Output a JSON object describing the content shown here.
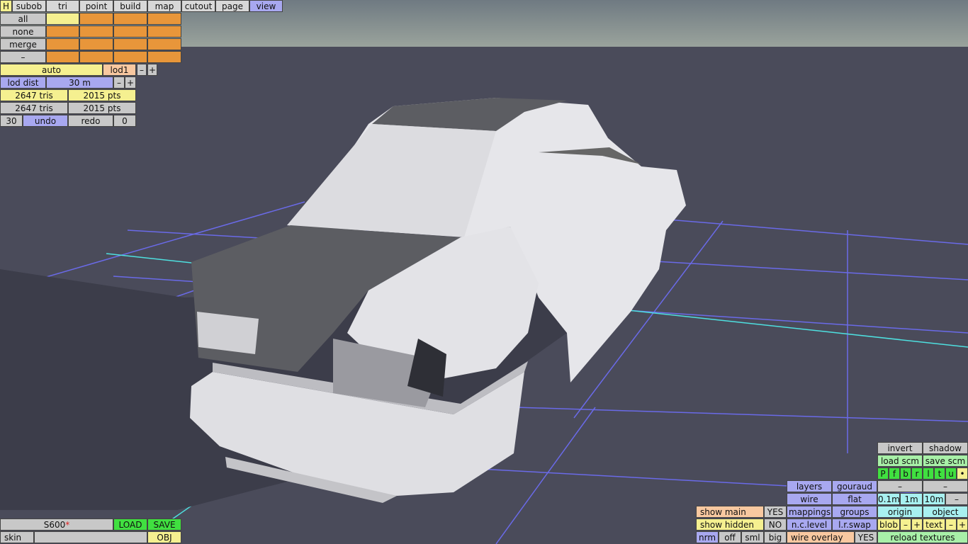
{
  "menu": {
    "h": "H",
    "subob": "subob",
    "tri": "tri",
    "point": "point",
    "build": "build",
    "map": "map",
    "cutout": "cutout",
    "page": "page",
    "view": "view"
  },
  "selection": {
    "all": "all",
    "none": "none",
    "merge": "merge",
    "dash": "–"
  },
  "lod": {
    "mode": "auto",
    "level": "lod1",
    "minus": "–",
    "plus": "+",
    "dist_label": "lod dist",
    "dist_value": "30 m"
  },
  "stats": {
    "tris1": "2647 tris",
    "pts1": "2015 pts",
    "tris2": "2647 tris",
    "pts2": "2015 pts"
  },
  "history": {
    "count": "30",
    "undo": "undo",
    "redo": "redo",
    "redo_count": "0"
  },
  "file": {
    "name": "S600",
    "modified_mark": "*",
    "load": "LOAD",
    "save": "SAVE",
    "skin": "skin",
    "obj": "OBJ"
  },
  "view_panel": {
    "invert": "invert",
    "shadow": "shadow",
    "load_scm": "load scm",
    "save_scm": "save scm",
    "views": [
      "P",
      "f",
      "b",
      "r",
      "l",
      "t",
      "u",
      "•"
    ],
    "layers": "layers",
    "gouraud": "gouraud",
    "dash1": "–",
    "dash2": "–",
    "wire": "wire",
    "flat": "flat",
    "g01": "0.1m",
    "g1": "1m",
    "g10": "10m",
    "gdash": "–",
    "show_main": "show main",
    "show_main_val": "YES",
    "mappings": "mappings",
    "groups": "groups",
    "origin": "origin",
    "object": "object",
    "show_hidden": "show hidden",
    "show_hidden_val": "NO",
    "nclevel": "n.c.level",
    "lrswap": "l.r.swap",
    "blob": "blob",
    "text": "text",
    "minus": "–",
    "plus": "+",
    "nrm": "nrm",
    "off": "off",
    "sml": "sml",
    "big": "big",
    "wire_overlay": "wire overlay",
    "wire_overlay_val": "YES",
    "reload": "reload textures"
  }
}
